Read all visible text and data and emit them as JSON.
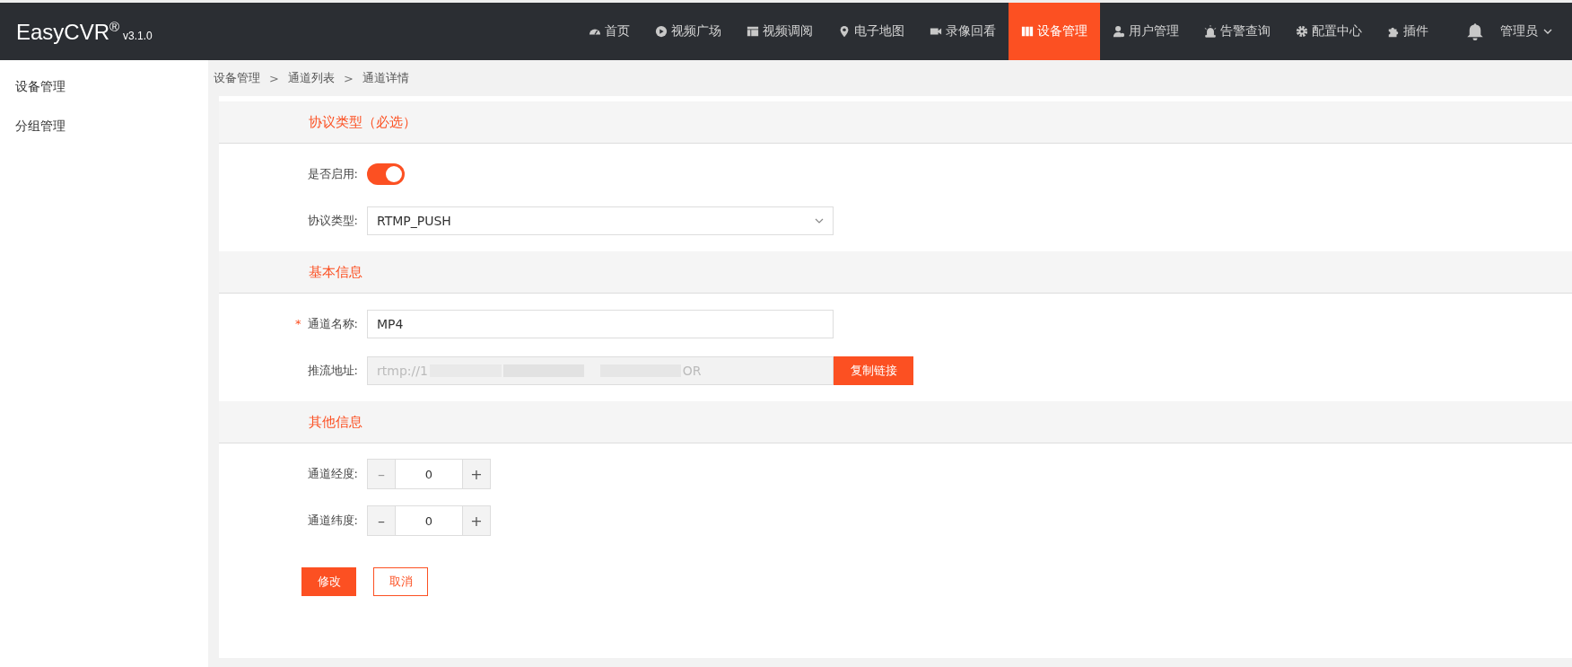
{
  "header": {
    "logo": "EasyCVR",
    "logo_mark": "®",
    "version": "v3.1.0",
    "nav": [
      {
        "label": "首页",
        "selected": false
      },
      {
        "label": "视频广场",
        "selected": false
      },
      {
        "label": "视频调阅",
        "selected": false
      },
      {
        "label": "电子地图",
        "selected": false
      },
      {
        "label": "录像回看",
        "selected": false
      },
      {
        "label": "设备管理",
        "selected": true
      },
      {
        "label": "用户管理",
        "selected": false
      },
      {
        "label": "告警查询",
        "selected": false
      },
      {
        "label": "配置中心",
        "selected": false
      },
      {
        "label": "插件",
        "selected": false
      }
    ],
    "user": "管理员"
  },
  "sidebar": {
    "items": [
      {
        "label": "设备管理",
        "selected": false
      },
      {
        "label": "分组管理",
        "selected": false
      }
    ]
  },
  "breadcrumb": [
    {
      "label": "设备管理"
    },
    {
      "separator": ">",
      "label": "通道列表"
    },
    {
      "separator": ">",
      "label": "通道详情"
    }
  ],
  "sections": [
    {
      "title": "协议类型（必选）",
      "fields": [
        {
          "kind": "switch",
          "label": "是否启用:",
          "on": true
        },
        {
          "kind": "select",
          "label": "协议类型:",
          "value": "RTMP_PUSH"
        }
      ]
    },
    {
      "title": "基本信息",
      "fields": [
        {
          "kind": "input",
          "label": "通道名称:",
          "required_mark": "*",
          "value": "MP4"
        },
        {
          "kind": "url",
          "label": "推流地址:",
          "value_start": "rtmp://1",
          "value_end": "OR",
          "button": "复制链接"
        }
      ]
    },
    {
      "title": "其他信息",
      "fields": [
        {
          "kind": "stepper",
          "label": "通道经度:",
          "value": "0",
          "minus": "–",
          "plus": "+",
          "minus_disabled": true
        },
        {
          "kind": "stepper",
          "label": "通道纬度:",
          "value": "0",
          "minus": "–",
          "plus": "+",
          "minus_disabled": false
        }
      ]
    }
  ],
  "actions": {
    "submit": "修改",
    "cancel": "取消"
  }
}
